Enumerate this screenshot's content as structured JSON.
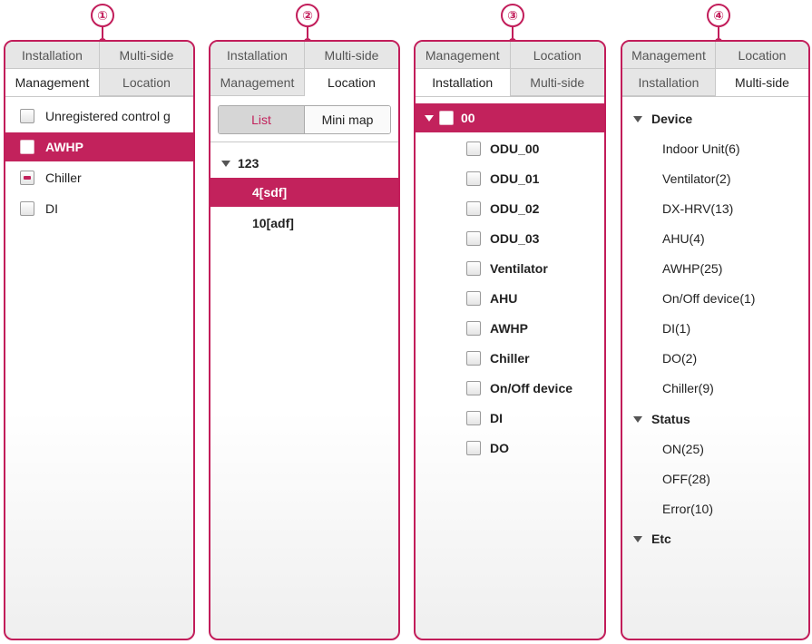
{
  "callouts": [
    "①",
    "②",
    "③",
    "④"
  ],
  "panel1": {
    "tabs_top": [
      "Installation",
      "Multi-side"
    ],
    "tabs_bottom": [
      "Management",
      "Location"
    ],
    "items": [
      {
        "label": "Unregistered control g",
        "state": "unchecked",
        "selected": false
      },
      {
        "label": "AWHP",
        "state": "unchecked",
        "selected": true
      },
      {
        "label": "Chiller",
        "state": "partial",
        "selected": false
      },
      {
        "label": "DI",
        "state": "unchecked",
        "selected": false
      }
    ]
  },
  "panel2": {
    "tabs_top": [
      "Installation",
      "Multi-side"
    ],
    "tabs_bottom": [
      "Management",
      "Location"
    ],
    "view_toggle": {
      "list_label": "List",
      "minimap_label": "Mini map",
      "active": "List"
    },
    "group": "123",
    "items": [
      {
        "label": "4[sdf]",
        "selected": true
      },
      {
        "label": "10[adf]",
        "selected": false
      }
    ]
  },
  "panel3": {
    "tabs_top": [
      "Management",
      "Location"
    ],
    "tabs_bottom": [
      "Installation",
      "Multi-side"
    ],
    "root": "00",
    "items": [
      "ODU_00",
      "ODU_01",
      "ODU_02",
      "ODU_03",
      "Ventilator",
      "AHU",
      "AWHP",
      "Chiller",
      "On/Off device",
      "DI",
      "DO"
    ]
  },
  "panel4": {
    "tabs_top": [
      "Management",
      "Location"
    ],
    "tabs_bottom": [
      "Installation",
      "Multi-side"
    ],
    "groups": [
      {
        "label": "Device",
        "items": [
          "Indoor Unit(6)",
          "Ventilator(2)",
          "DX-HRV(13)",
          "AHU(4)",
          "AWHP(25)",
          "On/Off device(1)",
          "DI(1)",
          "DO(2)",
          "Chiller(9)"
        ]
      },
      {
        "label": "Status",
        "items": [
          "ON(25)",
          "OFF(28)",
          "Error(10)"
        ]
      },
      {
        "label": "Etc",
        "items": []
      }
    ]
  },
  "colors": {
    "accent": "#c2225c",
    "outline": "#c21d5a",
    "tab_inactive": "#e6e6e6"
  }
}
